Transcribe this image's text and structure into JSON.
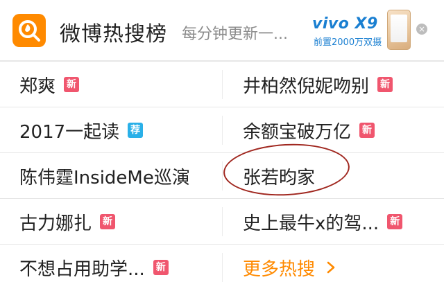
{
  "header": {
    "title": "微博热搜榜",
    "subtitle": "每分钟更新一...",
    "logo_icon": "search-fire-icon",
    "accent": "#ff8a00"
  },
  "ad": {
    "brand": "vivo X9",
    "tagline": "前置2000万双摄",
    "close": "×",
    "brand_color": "#1a7fd1"
  },
  "trending": [
    {
      "left": {
        "term": "郑爽",
        "badge": "新"
      },
      "right": {
        "term": "井柏然倪妮吻别",
        "badge": "新"
      }
    },
    {
      "left": {
        "term": "2017一起读",
        "badge": "荐"
      },
      "right": {
        "term": "余额宝破万亿",
        "badge": "新"
      }
    },
    {
      "left": {
        "term": "陈伟霆InsideMe巡演",
        "badge": ""
      },
      "right": {
        "term": "张若昀家",
        "badge": ""
      }
    },
    {
      "left": {
        "term": "古力娜扎",
        "badge": "新"
      },
      "right": {
        "term": "史上最牛x的驾...",
        "badge": "新"
      }
    },
    {
      "left": {
        "term": "不想占用助学...",
        "badge": "新"
      },
      "right": {
        "term": "更多热搜",
        "badge": ""
      }
    }
  ],
  "colors": {
    "badge_new": "#f0566e",
    "badge_recommend": "#2ab0e8",
    "more_link": "#ff8a00",
    "annotation_circle": "#a0271f"
  }
}
